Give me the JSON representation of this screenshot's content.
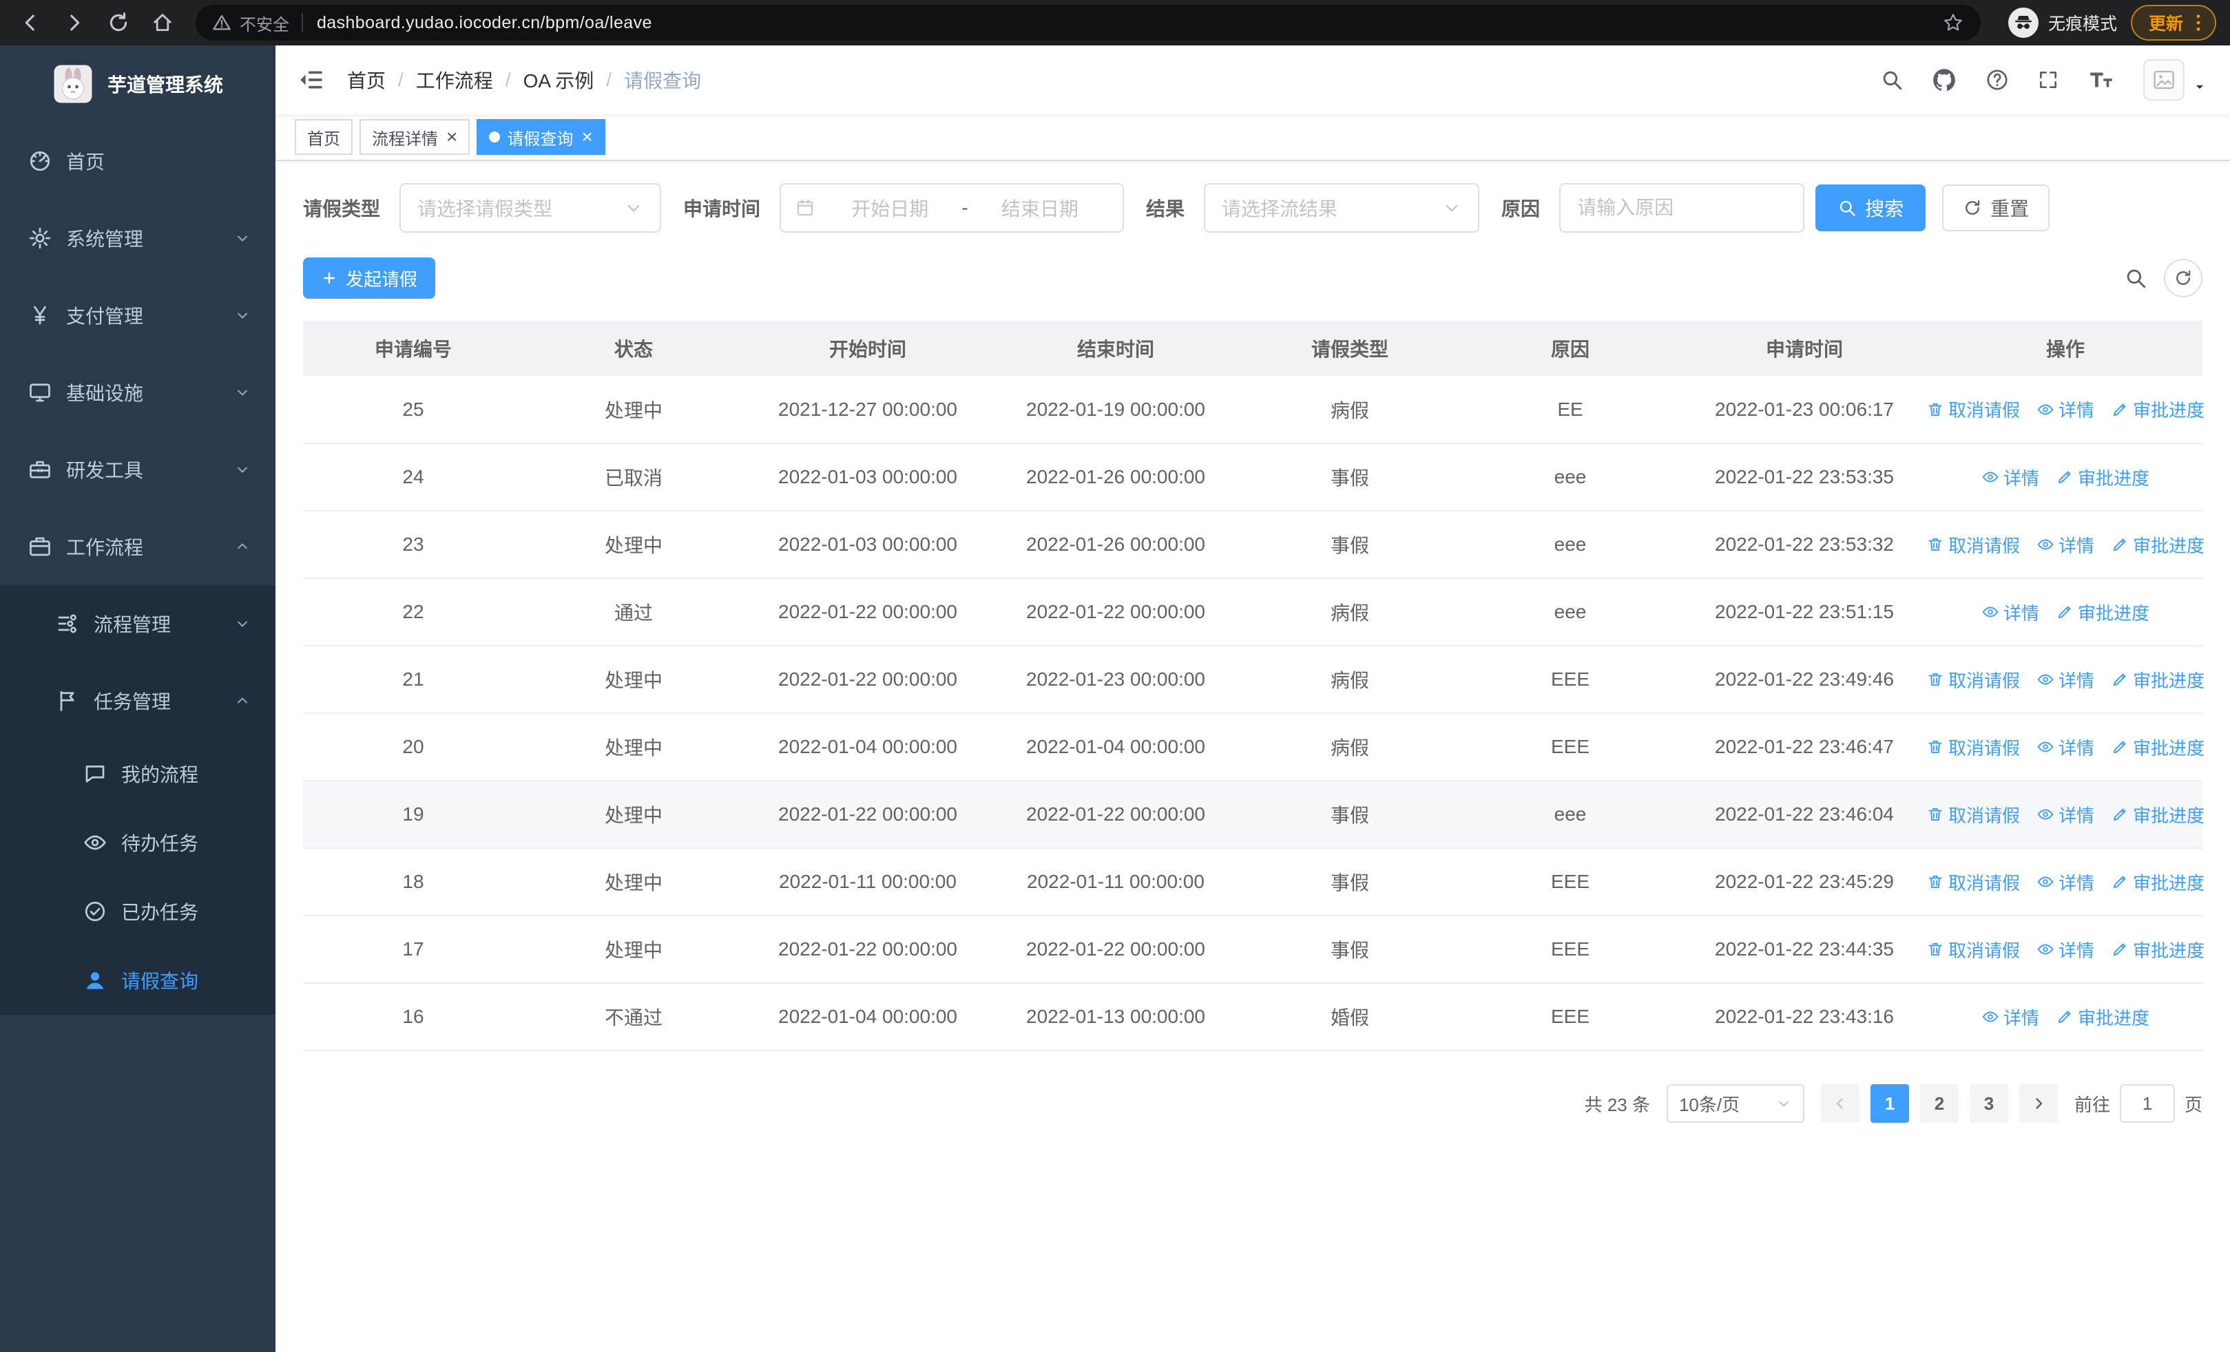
{
  "browser": {
    "security_label": "不安全",
    "url": "dashboard.yudao.iocoder.cn/bpm/oa/leave",
    "incognito_label": "无痕模式",
    "update_label": "更新"
  },
  "app": {
    "title": "芋道管理系统"
  },
  "sidebar": {
    "items": [
      {
        "key": "home",
        "label": "首页",
        "icon": "dashboard-icon",
        "level": 1
      },
      {
        "key": "system-management",
        "label": "系统管理",
        "icon": "gear-icon",
        "level": 1,
        "chevron": "down"
      },
      {
        "key": "payment-management",
        "label": "支付管理",
        "icon": "yen-icon",
        "level": 1,
        "chevron": "down"
      },
      {
        "key": "infrastructure",
        "label": "基础设施",
        "icon": "monitor-icon",
        "level": 1,
        "chevron": "down"
      },
      {
        "key": "dev-tools",
        "label": "研发工具",
        "icon": "toolbox-icon",
        "level": 1,
        "chevron": "down"
      },
      {
        "key": "workflow",
        "label": "工作流程",
        "icon": "briefcase-icon",
        "level": 1,
        "chevron": "up",
        "open": true
      },
      {
        "key": "process-management",
        "label": "流程管理",
        "icon": "flow-icon",
        "level": 2,
        "chevron": "down"
      },
      {
        "key": "task-management",
        "label": "任务管理",
        "icon": "flag-icon",
        "level": 2,
        "chevron": "up",
        "open": true
      },
      {
        "key": "my-processes",
        "label": "我的流程",
        "icon": "chat-icon",
        "level": 3
      },
      {
        "key": "todo-tasks",
        "label": "待办任务",
        "icon": "eye-icon",
        "level": 3
      },
      {
        "key": "done-tasks",
        "label": "已办任务",
        "icon": "done-icon",
        "level": 3
      },
      {
        "key": "leave-query",
        "label": "请假查询",
        "icon": "user-icon",
        "level": 3,
        "active": true
      }
    ]
  },
  "navbar": {
    "breadcrumb": [
      "首页",
      "工作流程",
      "OA 示例",
      "请假查询"
    ],
    "icons": [
      "search-icon",
      "github-icon",
      "help-icon",
      "fullscreen-icon",
      "font-size-icon"
    ]
  },
  "tabs": [
    {
      "key": "home",
      "label": "首页",
      "closable": false,
      "active": false
    },
    {
      "key": "process-detail",
      "label": "流程详情",
      "closable": true,
      "active": false
    },
    {
      "key": "leave-query",
      "label": "请假查询",
      "closable": true,
      "active": true
    }
  ],
  "filters": {
    "leave_type_label": "请假类型",
    "leave_type_placeholder": "请选择请假类型",
    "apply_time_label": "申请时间",
    "start_date_placeholder": "开始日期",
    "range_separator": "-",
    "end_date_placeholder": "结束日期",
    "result_label": "结果",
    "result_placeholder": "请选择流结果",
    "reason_label": "原因",
    "reason_placeholder": "请输入原因",
    "search_button": "搜索",
    "reset_button": "重置"
  },
  "toolbar": {
    "create_button": "发起请假"
  },
  "table": {
    "columns": [
      "申请编号",
      "状态",
      "开始时间",
      "结束时间",
      "请假类型",
      "原因",
      "申请时间",
      "操作"
    ],
    "actions": [
      {
        "key": "cancel-leave",
        "label": "取消请假",
        "icon": "trash-icon"
      },
      {
        "key": "detail",
        "label": "详情",
        "icon": "eye-icon"
      },
      {
        "key": "approval-progress",
        "label": "审批进度",
        "icon": "edit-icon"
      }
    ],
    "rows": [
      {
        "id": "25",
        "status": "处理中",
        "start": "2021-12-27 00:00:00",
        "end": "2022-01-19 00:00:00",
        "type": "病假",
        "reason": "EE",
        "applied": "2022-01-23 00:06:17",
        "can_cancel": true
      },
      {
        "id": "24",
        "status": "已取消",
        "start": "2022-01-03 00:00:00",
        "end": "2022-01-26 00:00:00",
        "type": "事假",
        "reason": "eee",
        "applied": "2022-01-22 23:53:35",
        "can_cancel": false
      },
      {
        "id": "23",
        "status": "处理中",
        "start": "2022-01-03 00:00:00",
        "end": "2022-01-26 00:00:00",
        "type": "事假",
        "reason": "eee",
        "applied": "2022-01-22 23:53:32",
        "can_cancel": true
      },
      {
        "id": "22",
        "status": "通过",
        "start": "2022-01-22 00:00:00",
        "end": "2022-01-22 00:00:00",
        "type": "病假",
        "reason": "eee",
        "applied": "2022-01-22 23:51:15",
        "can_cancel": false
      },
      {
        "id": "21",
        "status": "处理中",
        "start": "2022-01-22 00:00:00",
        "end": "2022-01-23 00:00:00",
        "type": "病假",
        "reason": "EEE",
        "applied": "2022-01-22 23:49:46",
        "can_cancel": true
      },
      {
        "id": "20",
        "status": "处理中",
        "start": "2022-01-04 00:00:00",
        "end": "2022-01-04 00:00:00",
        "type": "病假",
        "reason": "EEE",
        "applied": "2022-01-22 23:46:47",
        "can_cancel": true
      },
      {
        "id": "19",
        "status": "处理中",
        "start": "2022-01-22 00:00:00",
        "end": "2022-01-22 00:00:00",
        "type": "事假",
        "reason": "eee",
        "applied": "2022-01-22 23:46:04",
        "can_cancel": true,
        "highlighted": true
      },
      {
        "id": "18",
        "status": "处理中",
        "start": "2022-01-11 00:00:00",
        "end": "2022-01-11 00:00:00",
        "type": "事假",
        "reason": "EEE",
        "applied": "2022-01-22 23:45:29",
        "can_cancel": true
      },
      {
        "id": "17",
        "status": "处理中",
        "start": "2022-01-22 00:00:00",
        "end": "2022-01-22 00:00:00",
        "type": "事假",
        "reason": "EEE",
        "applied": "2022-01-22 23:44:35",
        "can_cancel": true
      },
      {
        "id": "16",
        "status": "不通过",
        "start": "2022-01-04 00:00:00",
        "end": "2022-01-13 00:00:00",
        "type": "婚假",
        "reason": "EEE",
        "applied": "2022-01-22 23:43:16",
        "can_cancel": false
      }
    ]
  },
  "pagination": {
    "total_label": "共 23 条",
    "page_size": "10条/页",
    "pages": [
      "1",
      "2",
      "3"
    ],
    "active_page": "1",
    "goto_label": "前往",
    "goto_value": "1",
    "page_label": "页"
  },
  "colors": {
    "primary": "#409eff",
    "sidebar_bg": "#2b3a4a",
    "submenu_bg": "#1f2d3d",
    "sidebar_text": "#bfcbd9",
    "table_header_bg": "#f0f2f5",
    "link": "#409eff",
    "update_badge": "#f29900"
  }
}
